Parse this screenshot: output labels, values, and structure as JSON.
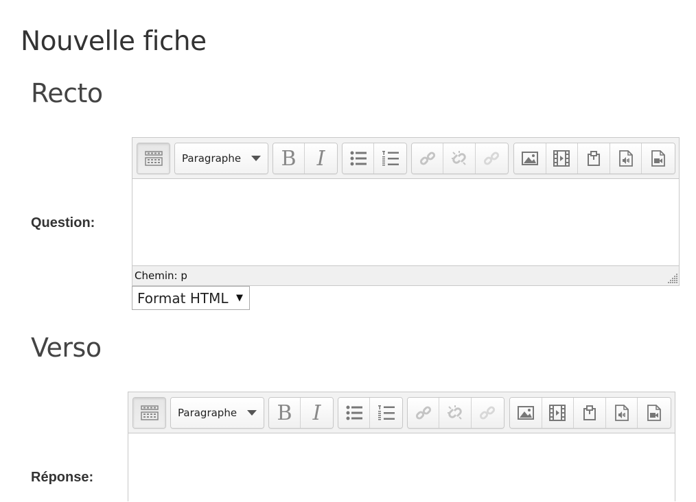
{
  "page": {
    "title": "Nouvelle fiche"
  },
  "recto": {
    "title": "Recto",
    "field_label": "Question:",
    "editor": {
      "block_format": "Paragraphe",
      "status_path": "Chemin: p"
    },
    "text_format": "Format HTML"
  },
  "verso": {
    "title": "Verso",
    "field_label": "Réponse:",
    "editor": {
      "block_format": "Paragraphe"
    }
  },
  "toolbar": {
    "toggle_icon": "toolbar-toggle-icon",
    "bold_label": "B",
    "italic_label": "I",
    "icons": [
      "bullet-list-icon",
      "numbered-list-icon",
      "link-icon",
      "unlink-icon",
      "anchor-icon",
      "image-icon",
      "media-icon",
      "paste-icon",
      "audio-record-icon",
      "video-record-icon"
    ]
  }
}
